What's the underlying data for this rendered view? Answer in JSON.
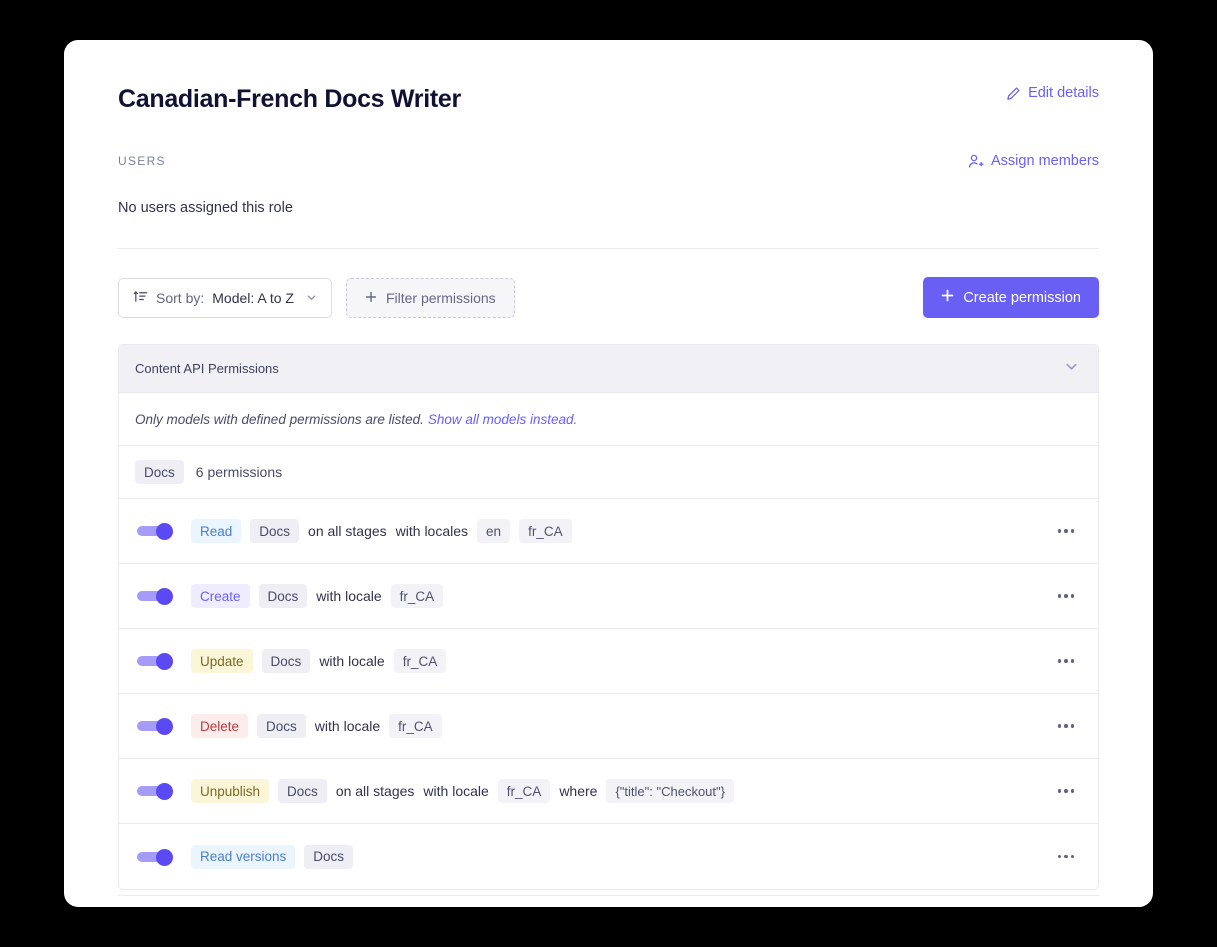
{
  "page": {
    "title": "Canadian-French Docs Writer"
  },
  "header_actions": {
    "edit_details": {
      "label": "Edit details",
      "icon": "pencil-icon"
    },
    "assign_members": {
      "label": "Assign members",
      "icon": "user-plus-icon"
    }
  },
  "users": {
    "section_label": "USERS",
    "empty_text": "No users assigned this role"
  },
  "toolbar": {
    "sort": {
      "icon": "sort-icon",
      "prefix": "Sort by:",
      "value": "Model: A to Z",
      "chevron": "chevron-down-icon"
    },
    "filter": {
      "label": "Filter permissions",
      "icon": "plus-icon"
    },
    "create": {
      "label": "Create permission",
      "icon": "plus-icon"
    }
  },
  "permissions_panel": {
    "header": {
      "title": "Content API Permissions",
      "chevron": "chevron-down-icon",
      "expanded": true
    },
    "note": {
      "text": "Only models with defined permissions are listed.",
      "link": "Show all models instead."
    },
    "model": {
      "name": "Docs",
      "count_text": "6 permissions"
    },
    "rows": [
      {
        "enabled": true,
        "action": "Read",
        "action_style": "read",
        "model": "Docs",
        "parts": [
          {
            "type": "text",
            "value": "on all stages"
          },
          {
            "type": "text",
            "value": "with locales"
          },
          {
            "type": "value",
            "value": "en"
          },
          {
            "type": "value",
            "value": "fr_CA"
          }
        ],
        "menu": "row-menu-icon"
      },
      {
        "enabled": true,
        "action": "Create",
        "action_style": "create",
        "model": "Docs",
        "parts": [
          {
            "type": "text",
            "value": "with locale"
          },
          {
            "type": "value",
            "value": "fr_CA"
          }
        ],
        "menu": "row-menu-icon"
      },
      {
        "enabled": true,
        "action": "Update",
        "action_style": "update",
        "model": "Docs",
        "parts": [
          {
            "type": "text",
            "value": "with locale"
          },
          {
            "type": "value",
            "value": "fr_CA"
          }
        ],
        "menu": "row-menu-icon"
      },
      {
        "enabled": true,
        "action": "Delete",
        "action_style": "delete",
        "model": "Docs",
        "parts": [
          {
            "type": "text",
            "value": "with locale"
          },
          {
            "type": "value",
            "value": "fr_CA"
          }
        ],
        "menu": "row-menu-icon"
      },
      {
        "enabled": true,
        "action": "Unpublish",
        "action_style": "unpublish",
        "model": "Docs",
        "parts": [
          {
            "type": "text",
            "value": "on all stages"
          },
          {
            "type": "text",
            "value": "with locale"
          },
          {
            "type": "value",
            "value": "fr_CA"
          },
          {
            "type": "text",
            "value": "where"
          },
          {
            "type": "cond",
            "value": "{\"title\": \"Checkout\"}"
          }
        ],
        "menu": "row-menu-icon"
      },
      {
        "enabled": true,
        "action": "Read versions",
        "action_style": "read",
        "model": "Docs",
        "parts": [],
        "menu": "row-menu-icon"
      }
    ]
  },
  "colors": {
    "accent": "#6a5ff5",
    "toggle_on_knob": "#5b4af4",
    "toggle_on_track": "#a59bf8",
    "panel_header_bg": "#f0f0f5",
    "page_bg": "#000000",
    "card_bg": "#ffffff"
  }
}
